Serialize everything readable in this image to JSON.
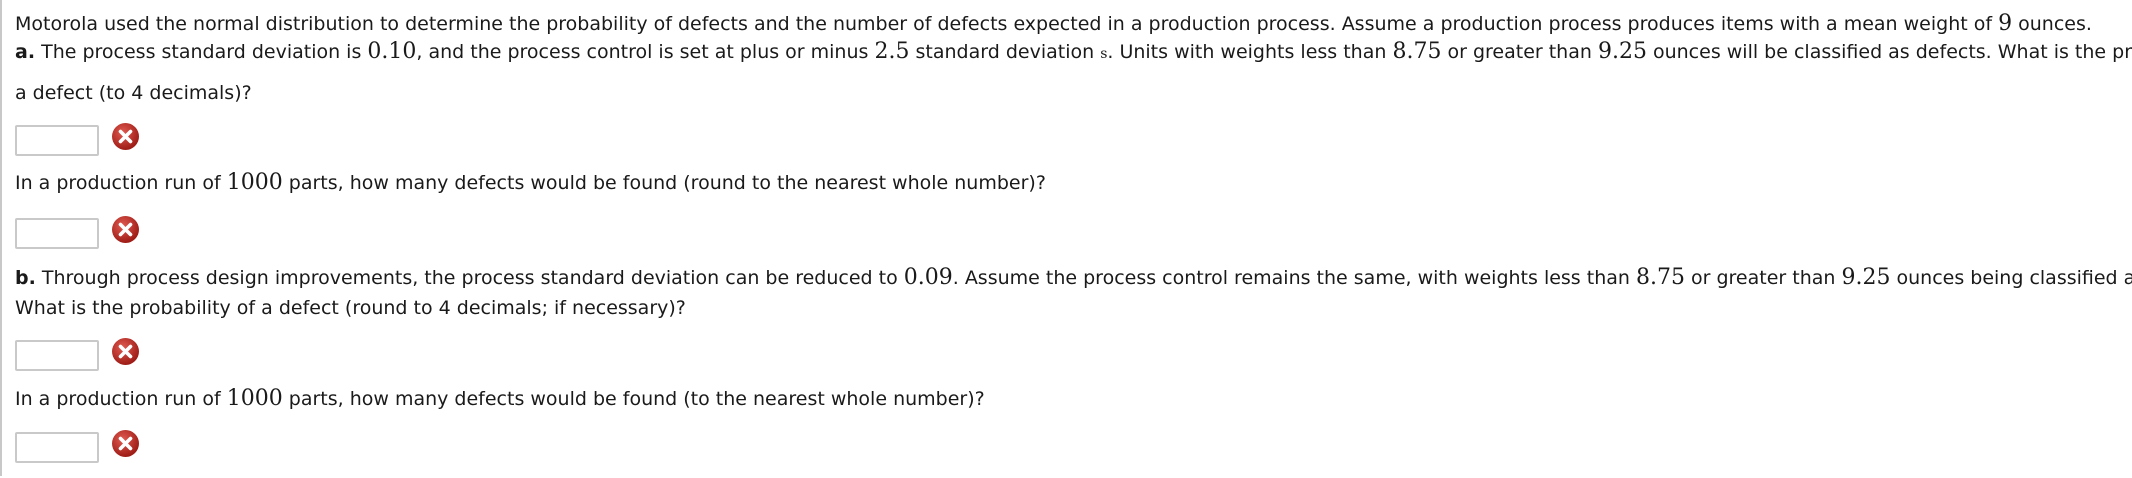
{
  "intro": {
    "t1": "Motorola used the normal distribution to determine the probability of defects and the number of defects expected in a production process. Assume a production process produces items with a mean weight of ",
    "mean": "9",
    "t2": " ounces."
  },
  "part_a": {
    "label": "a.",
    "t1": " The process standard deviation is ",
    "sd": "0.10",
    "t2": ", and the process control is set at plus or minus ",
    "k": "2.5",
    "t3": " standard deviation ",
    "s": "s",
    "t4": ". Units with weights less than ",
    "low": "8.75",
    "t5": " or greater than ",
    "high": "9.25",
    "t6": " ounces will be classified as defects. What is the probability of",
    "line2": "a defect (to 4 decimals)?",
    "q2_t1": "In a production run of ",
    "q2_n": "1000",
    "q2_t2": " parts, how many defects would be found (round to the nearest whole number)?"
  },
  "part_b": {
    "label": "b.",
    "t1": " Through process design improvements, the process standard deviation can be reduced to ",
    "sd": "0.09",
    "t2": ". Assume the process control remains the same, with weights less than ",
    "low": "8.75",
    "t3": " or greater than ",
    "high": "9.25",
    "t4": " ounces being classified as defects.",
    "line2": "What is the probability of a defect (round to 4 decimals; if necessary)?",
    "q2_t1": "In a production run of ",
    "q2_n": "1000",
    "q2_t2": " parts, how many defects would be found (to the nearest whole number)?"
  },
  "answers": {
    "a_probability": "",
    "a_defects": "",
    "b_probability": "",
    "b_defects": ""
  },
  "icons": {
    "incorrect": "incorrect-x-icon"
  },
  "colors": {
    "incorrect_icon": "#b5261f",
    "input_border": "#c9c9c9"
  }
}
